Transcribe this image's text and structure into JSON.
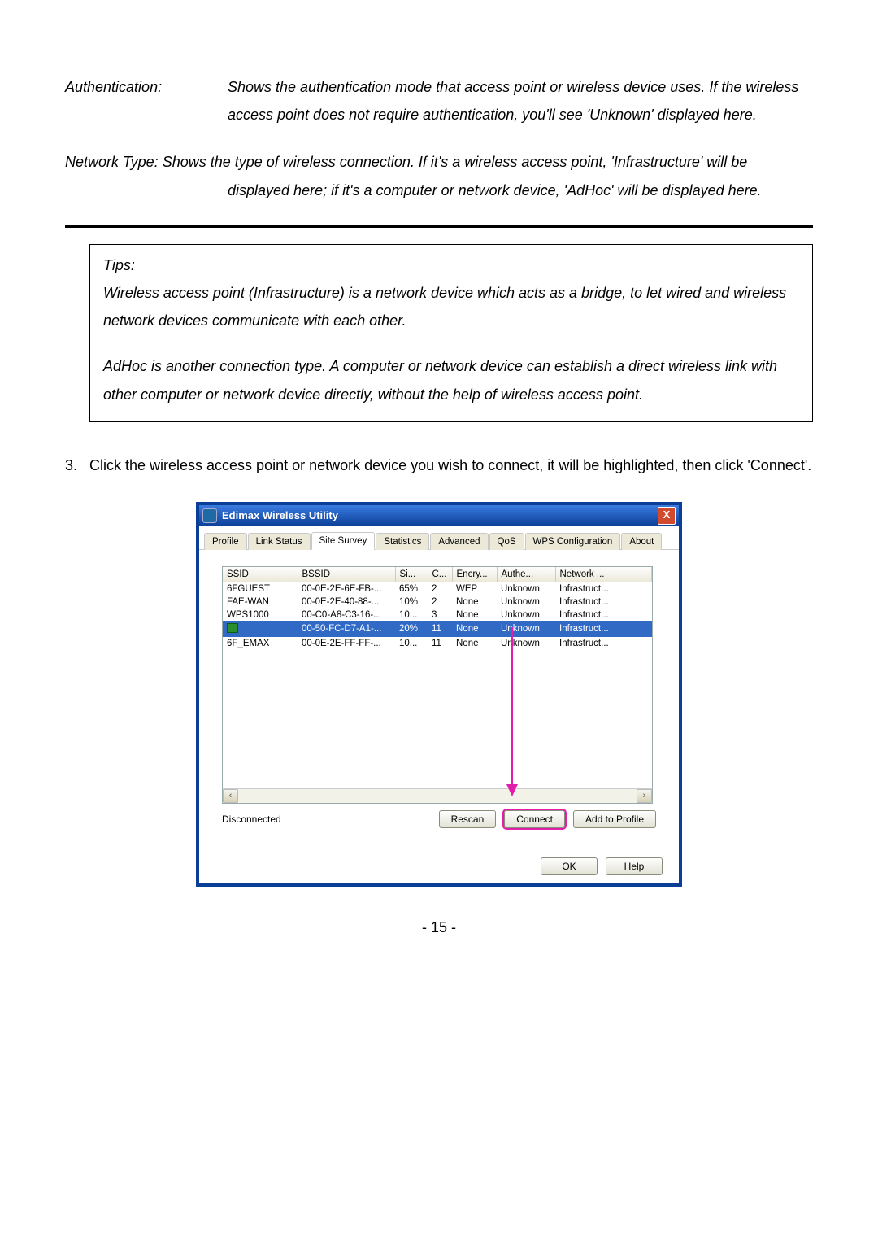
{
  "defs": {
    "auth_label": "Authentication:",
    "auth_body": "Shows the authentication mode that access point or wireless device uses. If the wireless access point does not require authentication, you'll see 'Unknown' displayed here."
  },
  "nettype": {
    "line1": "Network Type: Shows the type of wireless connection. If it's a wireless access point, 'Infrastructure' will be",
    "line2": "displayed here; if it's a computer or network device, 'AdHoc' will be displayed here."
  },
  "tips": {
    "title": "Tips:",
    "p1": "Wireless access point (Infrastructure) is a network device which acts as a bridge, to let wired and wireless network devices communicate with each other.",
    "p2": "AdHoc is another connection type. A computer or network device can establish a direct wireless link with other computer or network device directly, without the help of wireless access point."
  },
  "step": {
    "num": "3.",
    "text": "Click the wireless access point or network device you wish to connect, it will be highlighted, then click 'Connect'."
  },
  "window": {
    "title": "Edimax Wireless Utility",
    "close": "X",
    "tabs": [
      "Profile",
      "Link Status",
      "Site Survey",
      "Statistics",
      "Advanced",
      "QoS",
      "WPS Configuration",
      "About"
    ],
    "active_tab": 2,
    "cols": [
      "SSID",
      "BSSID",
      "Si...",
      "C...",
      "Encry...",
      "Authe...",
      "Network ..."
    ],
    "rows": [
      {
        "ssid": "6FGUEST",
        "bssid": "00-0E-2E-6E-FB-...",
        "si": "65%",
        "c": "2",
        "enc": "WEP",
        "auth": "Unknown",
        "net": "Infrastruct..."
      },
      {
        "ssid": "FAE-WAN",
        "bssid": "00-0E-2E-40-88-...",
        "si": "10%",
        "c": "2",
        "enc": "None",
        "auth": "Unknown",
        "net": "Infrastruct..."
      },
      {
        "ssid": "WPS1000",
        "bssid": "00-C0-A8-C3-16-...",
        "si": "10...",
        "c": "3",
        "enc": "None",
        "auth": "Unknown",
        "net": "Infrastruct..."
      },
      {
        "ssid": "",
        "bssid": "00-50-FC-D7-A1-...",
        "si": "20%",
        "c": "11",
        "enc": "None",
        "auth": "Unknown",
        "net": "Infrastruct...",
        "selected": true
      },
      {
        "ssid": "6F_EMAX",
        "bssid": "00-0E-2E-FF-FF-...",
        "si": "10...",
        "c": "11",
        "enc": "None",
        "auth": "Unknown",
        "net": "Infrastruct..."
      }
    ],
    "status": "Disconnected",
    "btn_rescan": "Rescan",
    "btn_connect": "Connect",
    "btn_addprofile": "Add to Profile",
    "btn_ok": "OK",
    "btn_help": "Help",
    "scroll_left": "‹",
    "scroll_right": "›"
  },
  "page_number": "- 15 -"
}
